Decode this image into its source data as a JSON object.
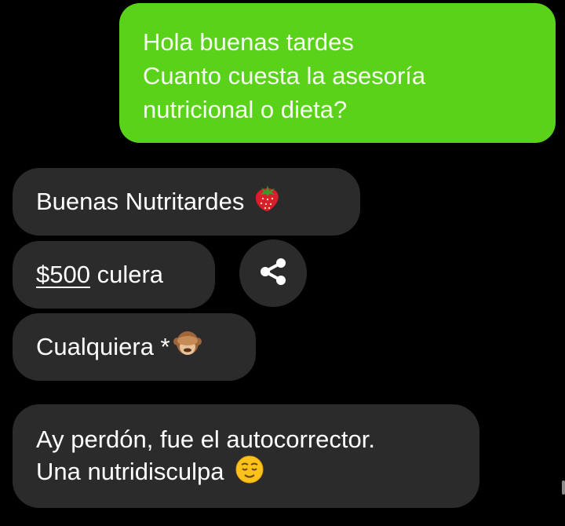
{
  "sent_message": {
    "lines": [
      "Hola buenas tardes",
      "Cuanto cuesta la asesoría",
      "nutricional o dieta?"
    ]
  },
  "received_messages": [
    {
      "text": "Buenas Nutritardes",
      "emoji": "strawberry-icon"
    },
    {
      "price": "$500",
      "text": " culera"
    },
    {
      "text": "Cualquiera *",
      "emoji": "see-no-evil-monkey-icon"
    },
    {
      "lines": [
        "Ay perdón, fue el autocorrector.",
        "Una nutridisculpa"
      ],
      "emoji": "relieved-face-icon"
    }
  ],
  "actions": {
    "share_icon": "share-icon"
  },
  "colors": {
    "background": "#000000",
    "sent_bubble": "#5bd21a",
    "received_bubble": "#2b2b2b",
    "text": "#ffffff"
  }
}
